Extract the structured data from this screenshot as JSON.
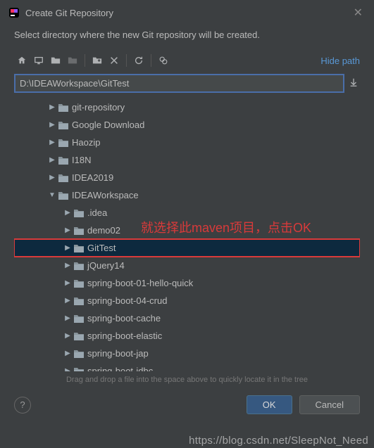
{
  "titlebar": {
    "title": "Create Git Repository"
  },
  "instruction": "Select directory where the new Git repository will be created.",
  "toolbar": {
    "hide_path": "Hide path"
  },
  "path": {
    "value": "D:\\IDEAWorkspace\\GitTest"
  },
  "tree": {
    "items": [
      {
        "indent": 1,
        "expanded": false,
        "label": "git-repository",
        "selected": false
      },
      {
        "indent": 1,
        "expanded": false,
        "label": "Google Download",
        "selected": false
      },
      {
        "indent": 1,
        "expanded": false,
        "label": "Haozip",
        "selected": false
      },
      {
        "indent": 1,
        "expanded": false,
        "label": "I18N",
        "selected": false
      },
      {
        "indent": 1,
        "expanded": false,
        "label": "IDEA2019",
        "selected": false
      },
      {
        "indent": 1,
        "expanded": true,
        "label": "IDEAWorkspace",
        "selected": false
      },
      {
        "indent": 2,
        "expanded": false,
        "label": ".idea",
        "selected": false
      },
      {
        "indent": 2,
        "expanded": false,
        "label": "demo02",
        "selected": false
      },
      {
        "indent": 2,
        "expanded": false,
        "label": "GitTest",
        "selected": true
      },
      {
        "indent": 2,
        "expanded": false,
        "label": "jQuery14",
        "selected": false
      },
      {
        "indent": 2,
        "expanded": false,
        "label": "spring-boot-01-hello-quick",
        "selected": false
      },
      {
        "indent": 2,
        "expanded": false,
        "label": "spring-boot-04-crud",
        "selected": false
      },
      {
        "indent": 2,
        "expanded": false,
        "label": "spring-boot-cache",
        "selected": false
      },
      {
        "indent": 2,
        "expanded": false,
        "label": "spring-boot-elastic",
        "selected": false
      },
      {
        "indent": 2,
        "expanded": false,
        "label": "spring-boot-jap",
        "selected": false
      },
      {
        "indent": 2,
        "expanded": false,
        "label": "spring-boot-jdbc",
        "selected": false
      }
    ]
  },
  "annotation": "就选择此maven项目，点击OK",
  "hint": "Drag and drop a file into the space above to quickly locate it in the tree",
  "buttons": {
    "ok": "OK",
    "cancel": "Cancel"
  },
  "watermark": "https://blog.csdn.net/SleepNot_Need"
}
